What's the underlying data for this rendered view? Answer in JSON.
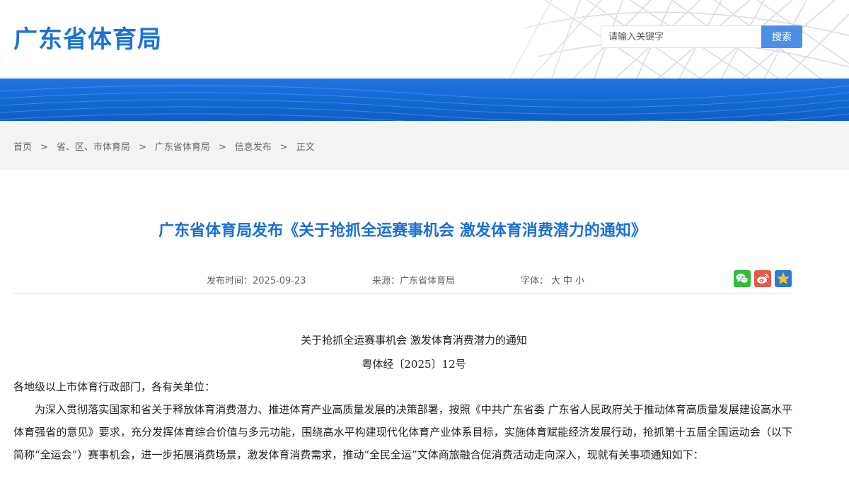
{
  "header": {
    "site_title": "广东省体育局",
    "search": {
      "placeholder": "请输入关键字",
      "button_label": "搜索"
    }
  },
  "breadcrumb": {
    "items": [
      "首页",
      "省、区、市体育局",
      "广东省体育局",
      "信息发布",
      "正文"
    ],
    "separator": ">"
  },
  "article": {
    "title": "广东省体育局发布《关于抢抓全运赛事机会 激发体育消费潜力的通知》",
    "meta": {
      "date_label": "发布时间：",
      "date": "2025-09-23",
      "source_label": "来源：",
      "source": "广东省体育局",
      "font_label": "字体：",
      "font_options": [
        "大",
        "中",
        "小"
      ]
    },
    "share": [
      "wechat-icon",
      "weibo-icon",
      "qzone-icon"
    ],
    "doc_title": "关于抢抓全运赛事机会 激发体育消费潜力的通知",
    "doc_number": "粤体经〔2025〕12号",
    "salutation": "各地级以上市体育行政部门，各有关单位：",
    "paragraph": "为深入贯彻落实国家和省关于释放体育消费潜力、推进体育产业高质量发展的决策部署，按照《中共广东省委 广东省人民政府关于推动体育高质量发展建设高水平体育强省的意见》要求，充分发挥体育综合价值与多元功能，围绕高水平构建现代化体育产业体系目标，实施体育赋能经济发展行动，抢抓第十五届全国运动会（以下简称“全运会”）赛事机会，进一步拓展消费场景，激发体育消费需求，推动“全民全运”文体商旅融合促消费活动走向深入，现就有关事项通知如下："
  },
  "colors": {
    "brand_blue": "#1a73d8",
    "title_blue": "#1a6fd6",
    "search_button": "#4b8fe6",
    "breadcrumb_bg": "#f3f3f3",
    "wechat_green": "#2fbd3b",
    "weibo_red": "#e8574a",
    "qzone_blue": "#2d7ad6"
  }
}
